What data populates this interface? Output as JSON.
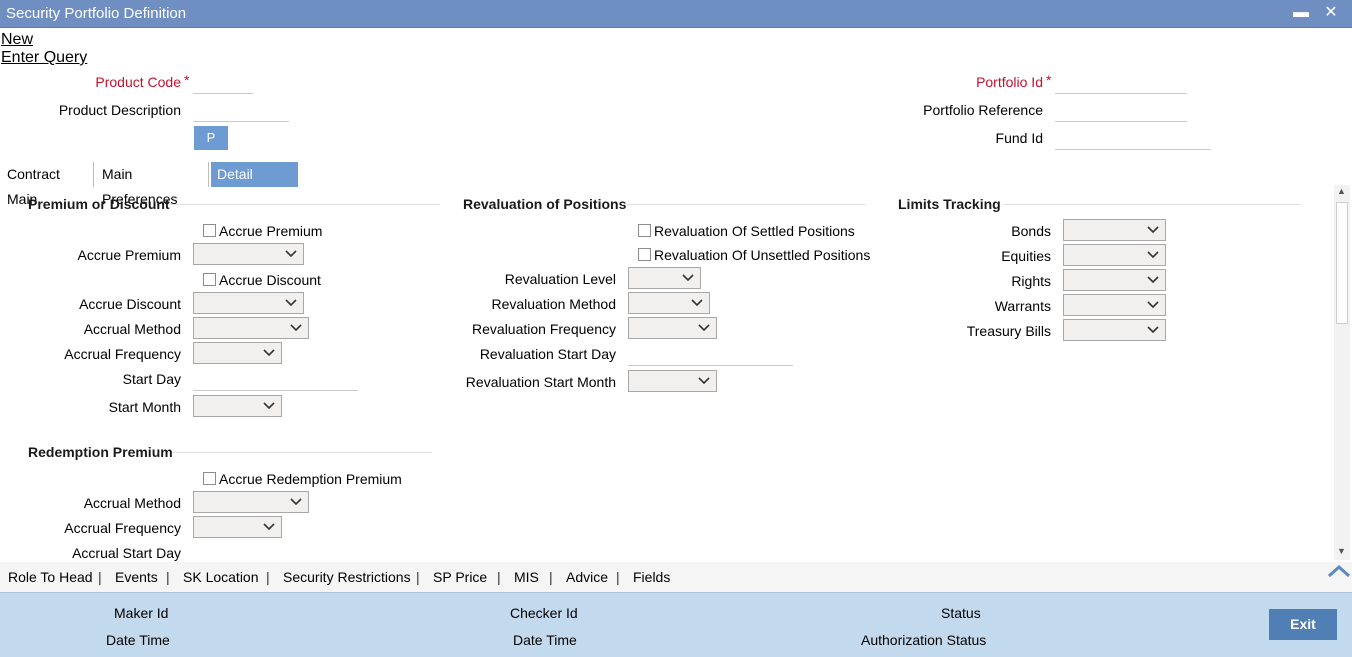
{
  "window": {
    "title": "Security Portfolio Definition",
    "minimize_glyph": "▬",
    "close_glyph": "✕"
  },
  "menu": {
    "new_label": "New",
    "enter_query_label": "Enter Query"
  },
  "header_fields": {
    "product_code_label": "Product Code",
    "required_marker": "*",
    "product_description_label": "Product Description",
    "p_button_label": "P",
    "portfolio_id_label": "Portfolio Id",
    "portfolio_reference_label": "Portfolio Reference",
    "fund_id_label": "Fund Id"
  },
  "tabs": [
    {
      "label": "Contract Main",
      "active": false
    },
    {
      "label": "Main Preferences",
      "active": false
    },
    {
      "label": "Detail Preferences",
      "active": true
    }
  ],
  "premium_discount": {
    "title": "Premium or Discount",
    "accrue_premium_checkbox": "Accrue Premium",
    "accrue_premium_label": "Accrue Premium",
    "accrue_discount_checkbox": "Accrue Discount",
    "accrue_discount_label": "Accrue Discount",
    "accrual_method_label": "Accrual Method",
    "accrual_frequency_label": "Accrual Frequency",
    "start_day_label": "Start Day",
    "start_month_label": "Start Month"
  },
  "redemption_premium": {
    "title": "Redemption Premium",
    "accrue_redemption_checkbox": "Accrue Redemption Premium",
    "accrual_method_label": "Accrual Method",
    "accrual_frequency_label": "Accrual Frequency",
    "accrual_start_day_label": "Accrual Start Day"
  },
  "revaluation": {
    "title": "Revaluation of Positions",
    "settled_checkbox": "Revaluation Of Settled Positions",
    "unsettled_checkbox": "Revaluation Of Unsettled Positions",
    "level_label": "Revaluation Level",
    "method_label": "Revaluation Method",
    "frequency_label": "Revaluation Frequency",
    "start_day_label": "Revaluation Start Day",
    "start_month_label": "Revaluation Start Month"
  },
  "limits_tracking": {
    "title": "Limits Tracking",
    "bonds_label": "Bonds",
    "equities_label": "Equities",
    "rights_label": "Rights",
    "warrants_label": "Warrants",
    "treasury_bills_label": "Treasury Bills"
  },
  "bottom_links": [
    "Role To Head",
    "Events",
    "SK Location",
    "Security Restrictions",
    "SP Price",
    "MIS",
    "Advice",
    "Fields"
  ],
  "link_separator": "|",
  "footer": {
    "maker_id_label": "Maker Id",
    "date_time_label_1": "Date Time",
    "checker_id_label": "Checker Id",
    "date_time_label_2": "Date Time",
    "status_label": "Status",
    "authorization_status_label": "Authorization Status",
    "exit_label": "Exit"
  },
  "colors": {
    "titlebar": "#6f8fc3",
    "active_tab": "#6f9bd3",
    "required": "#c8102e",
    "footer": "#c3d9ee",
    "exit_button": "#4f7fb4"
  }
}
